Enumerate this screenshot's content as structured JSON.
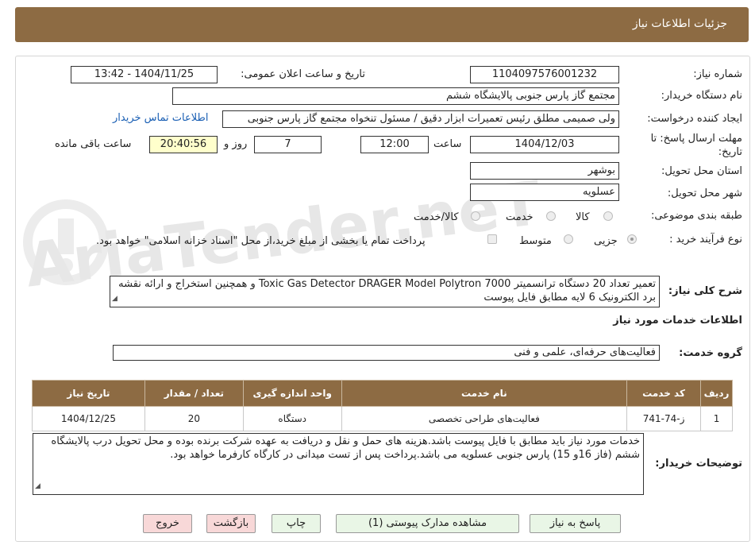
{
  "header": {
    "title": "جزئیات اطلاعات نیاز"
  },
  "watermark": {
    "text": "AriaTender.neT"
  },
  "form": {
    "need_number_label": "شماره نیاز:",
    "need_number": "1104097576001232",
    "announce_label": "تاریخ و ساعت اعلان عمومی:",
    "announce_value": "1404/11/25 - 13:42",
    "buyer_label": "نام دستگاه خریدار:",
    "buyer_value": "مجتمع گاز پارس جنوبی  پالایشگاه ششم",
    "creator_label": "ایجاد کننده درخواست:",
    "creator_value": "ولی صمیمی مطلق رئیس تعمیرات ابزار دقیق / مسئول تنخواه مجتمع گاز پارس جنوبی",
    "contact_link": "اطلاعات تماس خریدار",
    "deadline_label": "مهلت ارسال پاسخ: تا",
    "deadline_label2": "تاریخ:",
    "deadline_date": "1404/12/03",
    "time_label": "ساعت",
    "deadline_time": "12:00",
    "days_value": "7",
    "days_label": "روز و",
    "remaining_time": "20:40:56",
    "remaining_label": "ساعت باقی مانده",
    "province_label": "استان محل تحویل:",
    "province_value": "بوشهر",
    "city_label": "شهر محل تحویل:",
    "city_value": "عسلویه",
    "category_label": "طبقه بندی موضوعی:",
    "category_options": [
      "کالا",
      "خدمت",
      "کالا/خدمت"
    ],
    "category_selected": "",
    "process_label": "نوع فرآیند خرید :",
    "process_options": [
      "جزیی",
      "متوسط"
    ],
    "process_selected": "جزیی",
    "payment_note": "پرداخت تمام یا بخشی از مبلغ خرید،از محل \"اسناد خزانه اسلامی\" خواهد بود.",
    "summary_label": "شرح کلی نیاز:",
    "summary_value": "تعمیر تعداد 20 دستگاه ترانسمیتر Toxic Gas Detector DRAGER Model Polytron 7000 و همچنین استخراج و ارائه نقشه برد الکترونیک 6 لایه مطابق فایل پیوست",
    "services_heading": "اطلاعات خدمات مورد نیاز",
    "service_group_label": "گروه خدمت:",
    "service_group_value": "فعالیت‌های حرفه‌ای، علمی و فنی"
  },
  "table": {
    "headers": [
      "ردیف",
      "کد خدمت",
      "نام خدمت",
      "واحد اندازه گیری",
      "تعداد / مقدار",
      "تاریخ نیاز"
    ],
    "rows": [
      [
        "1",
        "ز-74-741",
        "فعالیت‌های طراحی تخصصی",
        "دستگاه",
        "20",
        "1404/12/25"
      ]
    ]
  },
  "notes": {
    "label": "توضیحات خریدار:",
    "value": "خدمات مورد نیاز باید مطابق با فایل پیوست باشد.هزینه های حمل و نقل و دریافت به عهده شرکت برنده بوده و محل تحویل درب پالایشگاه ششم (فاز 16و 15) پارس جنوبی عسلویه می باشد.پرداخت پس از تست میدانی در کارگاه کارفرما خواهد بود."
  },
  "buttons": {
    "reply": "پاسخ به نیاز",
    "attachments": "مشاهده مدارک پیوستی (1)",
    "print": "چاپ",
    "back": "بازگشت",
    "exit": "خروج"
  },
  "colors": {
    "header_bg": "#8d6b43",
    "table_header_bg": "#8d6b43",
    "button_green": "#e9f6e6",
    "button_red": "#f8d8d8",
    "remaining_bg": "#ffffcc",
    "link": "#1a5fb4"
  }
}
